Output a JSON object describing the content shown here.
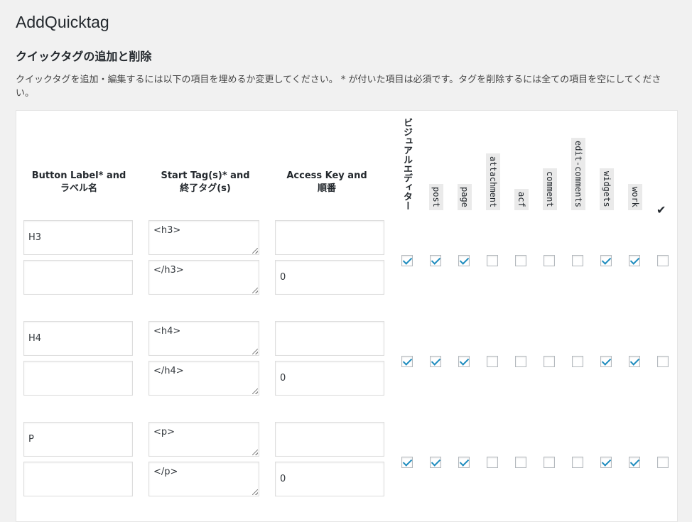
{
  "page": {
    "title": "AddQuicktag",
    "section_title": "クイックタグの追加と削除",
    "description": "クイックタグを追加・編集するには以下の項目を埋めるか変更してください。 * が付いた項目は必須です。タグを削除するには全ての項目を空にしてください。"
  },
  "table": {
    "headers": {
      "button_label": [
        "Button Label* and",
        "ラベル名"
      ],
      "start_tag": [
        "Start Tag(s)* and",
        "終了タグ(s)"
      ],
      "access_key": [
        "Access Key and",
        "順番"
      ]
    },
    "checkbox_columns": [
      "ビジュアルエディター",
      "post",
      "page",
      "attachment",
      "acf",
      "comment",
      "edit-comments",
      "widgets",
      "work",
      "✔"
    ],
    "rows": [
      {
        "label": "H3",
        "label2": "",
        "start_tag": "<h3>",
        "end_tag": "</h3>",
        "access_key": "",
        "order": "0",
        "checks": [
          true,
          true,
          true,
          false,
          false,
          false,
          false,
          true,
          true,
          false
        ]
      },
      {
        "label": "H4",
        "label2": "",
        "start_tag": "<h4>",
        "end_tag": "</h4>",
        "access_key": "",
        "order": "0",
        "checks": [
          true,
          true,
          true,
          false,
          false,
          false,
          false,
          true,
          true,
          false
        ]
      },
      {
        "label": "P",
        "label2": "",
        "start_tag": "<p>",
        "end_tag": "</p>",
        "access_key": "",
        "order": "0",
        "checks": [
          true,
          true,
          true,
          false,
          false,
          false,
          false,
          true,
          true,
          false
        ]
      }
    ]
  },
  "colors": {
    "checkmark": "#1e8cbe",
    "background": "#f1f1f1"
  }
}
